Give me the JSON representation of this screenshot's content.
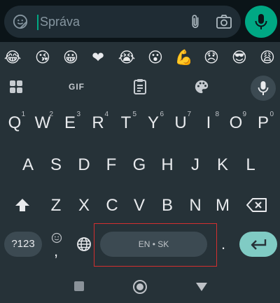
{
  "message_bar": {
    "placeholder": "Správa",
    "value": ""
  },
  "emoji_row": [
    {
      "name": "face-with-tears-of-joy-icon",
      "char": "😂"
    },
    {
      "name": "face-blowing-kiss-icon",
      "char": "😘"
    },
    {
      "name": "smiling-face-icon",
      "char": "😀"
    },
    {
      "name": "red-heart-icon",
      "char": "❤"
    },
    {
      "name": "crying-face-icon",
      "char": "😭"
    },
    {
      "name": "surprised-face-icon",
      "char": "😮"
    },
    {
      "name": "flexed-biceps-icon",
      "char": "💪"
    },
    {
      "name": "disappointed-face-icon",
      "char": "😞"
    },
    {
      "name": "sunglasses-face-icon",
      "char": "😎"
    },
    {
      "name": "weary-face-icon",
      "char": "😩"
    }
  ],
  "toolbar": {
    "gif_label": "GIF"
  },
  "keyboard": {
    "row1": [
      {
        "key": "Q",
        "hint": "1"
      },
      {
        "key": "W",
        "hint": "2"
      },
      {
        "key": "E",
        "hint": "3"
      },
      {
        "key": "R",
        "hint": "4"
      },
      {
        "key": "T",
        "hint": "5"
      },
      {
        "key": "Y",
        "hint": "6"
      },
      {
        "key": "U",
        "hint": "7"
      },
      {
        "key": "I",
        "hint": "8"
      },
      {
        "key": "O",
        "hint": "9"
      },
      {
        "key": "P",
        "hint": "0"
      }
    ],
    "row2": [
      "A",
      "S",
      "D",
      "F",
      "G",
      "H",
      "J",
      "K",
      "L"
    ],
    "row3": [
      "Z",
      "X",
      "C",
      "V",
      "B",
      "N",
      "M"
    ],
    "num_key_label": "?123",
    "comma_label": ",",
    "period_label": ".",
    "space_label": "EN • SK"
  },
  "colors": {
    "keyboard_bg": "#263238",
    "accent": "#00a884",
    "enter": "#80cbc4"
  }
}
